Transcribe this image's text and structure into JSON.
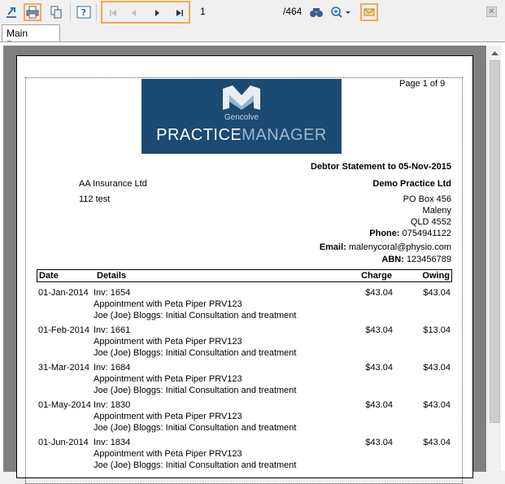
{
  "toolbar": {
    "page_value": "1",
    "page_total": "/464",
    "icons": [
      "export-icon",
      "print-icon",
      "copy-icon",
      "help-icon",
      "first-page-icon",
      "prev-page-icon",
      "next-page-icon",
      "last-page-icon",
      "find-icon",
      "zoom-icon",
      "email-icon",
      "close-icon"
    ]
  },
  "tab": {
    "label": "Main Report"
  },
  "report": {
    "page_label": "Page 1 of 9",
    "logo_sub": "Gencolve",
    "logo_main_1": "PRACTICE",
    "logo_main_2": "MANAGER",
    "statement_title": "Debtor Statement to 05-Nov-2015",
    "debtor": {
      "name": "AA Insurance Ltd",
      "address": "112 test"
    },
    "practice": {
      "name": "Demo Practice Ltd",
      "address1": "PO Box 456",
      "address2": "Maleny",
      "address3": "QLD 4552",
      "phone_label": "Phone:",
      "phone": "0754941122",
      "email_label": "Email:",
      "email": "malenycoral@physio.com",
      "abn_label": "ABN:",
      "abn": "123456789"
    },
    "columns": {
      "date": "Date",
      "details": "Details",
      "charge": "Charge",
      "owing": "Owing"
    },
    "rows": [
      {
        "date": "01-Jan-2014",
        "inv": "Inv: 1654",
        "appt": "Appointment with Peta Piper PRV123",
        "desc": "Joe (Joe) Bloggs: Initial Consultation and treatment",
        "charge": "$43.04",
        "owing": "$43.04"
      },
      {
        "date": "01-Feb-2014",
        "inv": "Inv: 1661",
        "appt": "Appointment with Peta Piper PRV123",
        "desc": "Joe (Joe) Bloggs: Initial Consultation and treatment",
        "charge": "$43.04",
        "owing": "$13.04"
      },
      {
        "date": "31-Mar-2014",
        "inv": "Inv: 1684",
        "appt": "Appointment with Peta Piper PRV123",
        "desc": "Joe (Joe) Bloggs: Initial Consultation and treatment",
        "charge": "$43.04",
        "owing": "$43.04"
      },
      {
        "date": "01-May-2014",
        "inv": "Inv: 1830",
        "appt": "Appointment with Peta Piper PRV123",
        "desc": "Joe (Joe) Bloggs: Initial Consultation and treatment",
        "charge": "$43.04",
        "owing": "$43.04"
      },
      {
        "date": "01-Jun-2014",
        "inv": "Inv: 1834",
        "appt": "Appointment with Peta Piper PRV123",
        "desc": "Joe (Joe) Bloggs: Initial Consultation and treatment",
        "charge": "$43.04",
        "owing": "$43.04"
      }
    ]
  }
}
